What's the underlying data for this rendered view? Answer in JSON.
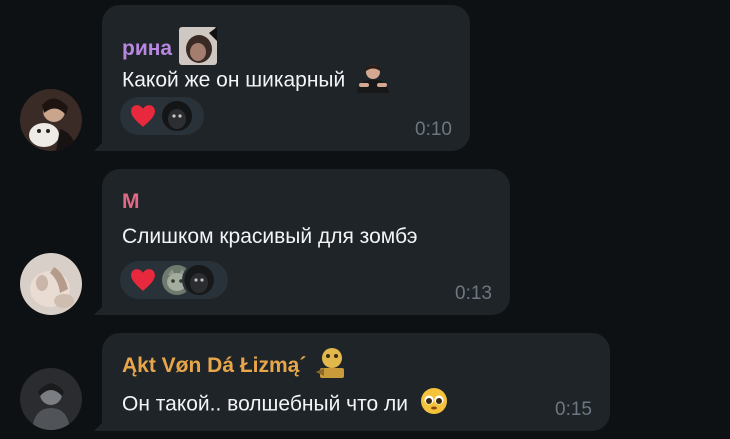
{
  "messages": [
    {
      "author": "рина",
      "author_color": "#b987e0",
      "text": "Какой же он шикарный",
      "time": "0:10",
      "reaction": "heart"
    },
    {
      "author": "M",
      "author_color": "#e06a86",
      "text": "Слишком красивый для зомбэ",
      "time": "0:13",
      "reaction": "heart"
    },
    {
      "author": "Ąkt Vøn Dá Łizmą´",
      "author_color": "#e8a64a",
      "text": "Он такой.. волшебный что ли",
      "time": "0:15",
      "reaction": ""
    }
  ],
  "colors": {
    "background": "#0e1114",
    "bubble": "#1f2428",
    "text": "#f2f4f6",
    "time": "#6d7781",
    "reaction_pill": "#283238",
    "heart": "#e8283c"
  }
}
